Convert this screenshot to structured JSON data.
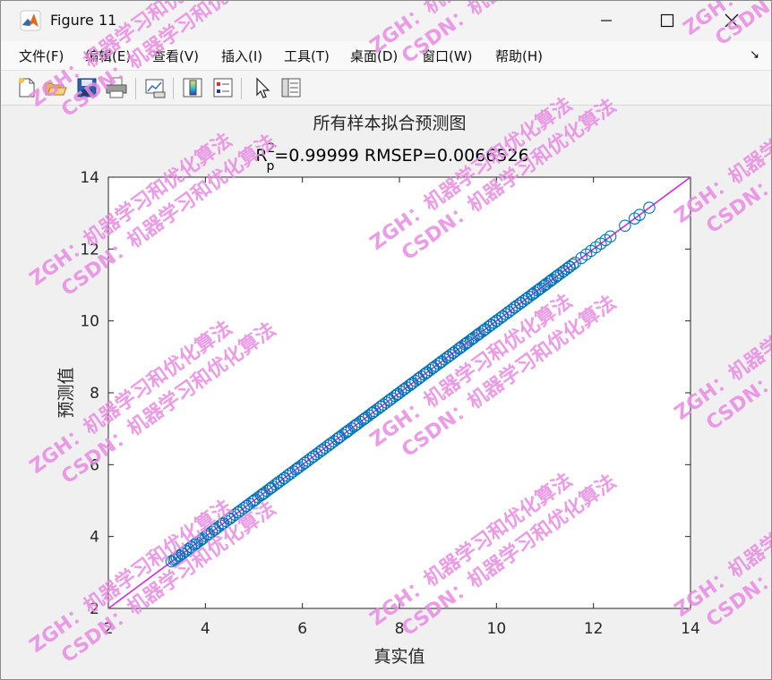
{
  "window": {
    "title": "Figure 11"
  },
  "menu": [
    "文件(F)",
    "编辑(E)",
    "查看(V)",
    "插入(I)",
    "工具(T)",
    "桌面(D)",
    "窗口(W)",
    "帮助(H)"
  ],
  "toolbar": [
    "new-figure",
    "open-file",
    "save-figure",
    "print-figure",
    "link-plot",
    "insert-colorbar",
    "insert-legend",
    "edit-plot",
    "property-inspector"
  ],
  "watermark": {
    "line1": "ZGH：机器学习和优化算法",
    "line2": "CSDN：机器学习和优化算法",
    "color": "#e98ae3"
  },
  "chart_data": {
    "type": "scatter",
    "title": "所有样本拟合预测图",
    "subtitle_prefix": "R",
    "subtitle_sup": "2",
    "subtitle_sub": "p",
    "subtitle_rest": "=0.99999  RMSEP=0.0066526",
    "xlabel": "真实值",
    "ylabel": "预测值",
    "xlim": [
      2,
      14
    ],
    "ylim": [
      2,
      14
    ],
    "xticks": [
      "2",
      "4",
      "6",
      "8",
      "10",
      "12",
      "14"
    ],
    "yticks": [
      "2",
      "4",
      "6",
      "8",
      "10",
      "12",
      "14"
    ],
    "marker_color": "#0072bd",
    "line_color": "#d62ae5",
    "reference_line": {
      "x": [
        2,
        14
      ],
      "y": [
        2,
        14
      ]
    },
    "series": [
      {
        "values_x": [
          3.3,
          3.38,
          3.45,
          3.52,
          3.6,
          3.7,
          3.8,
          3.92,
          4.05,
          4.2,
          4.35,
          4.5,
          4.68,
          4.85,
          5.0,
          5.18,
          5.35,
          5.5,
          5.62,
          5.75,
          5.9,
          6.05,
          6.22,
          6.4,
          6.58,
          6.75,
          6.92,
          7.1,
          7.28,
          7.45,
          7.62,
          7.8,
          7.95,
          8.1,
          8.25,
          8.4,
          8.55,
          8.7,
          8.85,
          9.0,
          9.12,
          9.25,
          9.38,
          9.5,
          9.62,
          9.75,
          9.88,
          10.0,
          10.12,
          10.25,
          10.38,
          10.5,
          10.62,
          10.75,
          10.88,
          11.0,
          11.12,
          11.25,
          11.38,
          11.5,
          11.62,
          11.75,
          11.85,
          11.95,
          12.05,
          12.15,
          12.25,
          12.35,
          12.65,
          12.85,
          12.95,
          13.15
        ],
        "values_y": [
          3.31,
          3.38,
          3.45,
          3.52,
          3.6,
          3.7,
          3.8,
          3.92,
          4.05,
          4.2,
          4.35,
          4.5,
          4.68,
          4.85,
          5.0,
          5.18,
          5.35,
          5.5,
          5.62,
          5.75,
          5.9,
          6.05,
          6.22,
          6.4,
          6.58,
          6.75,
          6.92,
          7.1,
          7.28,
          7.45,
          7.62,
          7.8,
          7.95,
          8.1,
          8.25,
          8.4,
          8.55,
          8.7,
          8.85,
          9.0,
          9.12,
          9.25,
          9.38,
          9.5,
          9.62,
          9.75,
          9.88,
          10.0,
          10.12,
          10.25,
          10.38,
          10.5,
          10.62,
          10.75,
          10.88,
          11.0,
          11.12,
          11.25,
          11.38,
          11.5,
          11.62,
          11.75,
          11.85,
          11.95,
          12.05,
          12.15,
          12.25,
          12.35,
          12.65,
          12.85,
          12.95,
          13.15
        ]
      }
    ]
  }
}
